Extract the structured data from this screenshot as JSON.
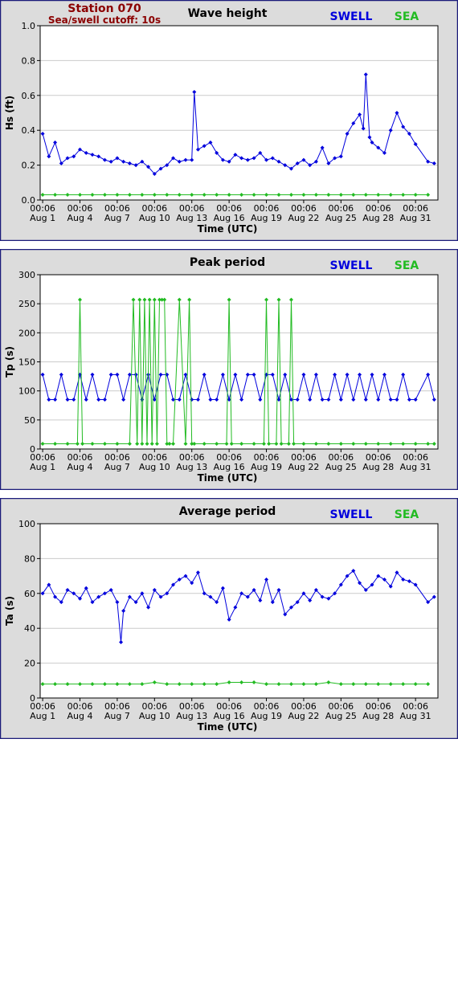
{
  "header": {
    "station": "Station 070",
    "cutoff": "Sea/swell cutoff: 10s"
  },
  "colors": {
    "swell": "#0000dd",
    "sea": "#22bb22",
    "frame": "#1a1a7a",
    "outer_bg": "#dcdcdc",
    "grid": "#cccccc"
  },
  "x_axis": {
    "label": "Time (UTC)",
    "days": 31,
    "ticks": [
      {
        "day": 1,
        "time": "00:06",
        "date": "Aug 1"
      },
      {
        "day": 4,
        "time": "00:06",
        "date": "Aug 4"
      },
      {
        "day": 7,
        "time": "00:06",
        "date": "Aug 7"
      },
      {
        "day": 10,
        "time": "00:06",
        "date": "Aug 10"
      },
      {
        "day": 13,
        "time": "00:06",
        "date": "Aug 13"
      },
      {
        "day": 16,
        "time": "00:06",
        "date": "Aug 16"
      },
      {
        "day": 19,
        "time": "00:06",
        "date": "Aug 19"
      },
      {
        "day": 22,
        "time": "00:06",
        "date": "Aug 22"
      },
      {
        "day": 25,
        "time": "00:06",
        "date": "Aug 25"
      },
      {
        "day": 28,
        "time": "00:06",
        "date": "Aug 28"
      },
      {
        "day": 31,
        "time": "00:06",
        "date": "Aug 31"
      }
    ]
  },
  "chart_data": [
    {
      "type": "line",
      "title": "Wave height",
      "ylabel": "Hs (ft)",
      "xlabel": "Time (UTC)",
      "ylim": [
        0,
        1.0
      ],
      "yticks": [
        "0.0",
        "0.2",
        "0.4",
        "0.6",
        "0.8",
        "1.0"
      ],
      "grid": true,
      "legend": "top-right",
      "series": [
        {
          "name": "SWELL",
          "color": "#0000dd",
          "x": [
            1.0,
            1.5,
            2.0,
            2.5,
            3.0,
            3.5,
            4.0,
            4.5,
            5.0,
            5.5,
            6.0,
            6.5,
            7.0,
            7.5,
            8.0,
            8.5,
            9.0,
            9.5,
            10.0,
            10.5,
            11.0,
            11.5,
            12.0,
            12.5,
            13.0,
            13.2,
            13.5,
            14.0,
            14.5,
            15.0,
            15.5,
            16.0,
            16.5,
            17.0,
            17.5,
            18.0,
            18.5,
            19.0,
            19.5,
            20.0,
            20.5,
            21.0,
            21.5,
            22.0,
            22.5,
            23.0,
            23.5,
            24.0,
            24.5,
            25.0,
            25.5,
            26.0,
            26.5,
            26.8,
            27.0,
            27.3,
            27.5,
            28.0,
            28.5,
            29.0,
            29.5,
            30.0,
            30.5,
            31.0,
            32.0,
            32.5
          ],
          "values": [
            0.38,
            0.25,
            0.33,
            0.21,
            0.24,
            0.25,
            0.29,
            0.27,
            0.26,
            0.25,
            0.23,
            0.22,
            0.24,
            0.22,
            0.21,
            0.2,
            0.22,
            0.19,
            0.15,
            0.18,
            0.2,
            0.24,
            0.22,
            0.23,
            0.23,
            0.62,
            0.29,
            0.31,
            0.33,
            0.27,
            0.23,
            0.22,
            0.26,
            0.24,
            0.23,
            0.24,
            0.27,
            0.23,
            0.24,
            0.22,
            0.2,
            0.18,
            0.21,
            0.23,
            0.2,
            0.22,
            0.3,
            0.21,
            0.24,
            0.25,
            0.38,
            0.44,
            0.49,
            0.41,
            0.72,
            0.36,
            0.33,
            0.3,
            0.27,
            0.4,
            0.5,
            0.42,
            0.38,
            0.32,
            0.22,
            0.21
          ]
        },
        {
          "name": "SEA",
          "color": "#22bb22",
          "x": [
            1.0,
            2.0,
            3.0,
            4.0,
            5.0,
            6.0,
            7.0,
            8.0,
            9.0,
            10.0,
            11.0,
            12.0,
            13.0,
            14.0,
            15.0,
            16.0,
            17.0,
            18.0,
            19.0,
            20.0,
            21.0,
            22.0,
            23.0,
            24.0,
            25.0,
            26.0,
            27.0,
            28.0,
            29.0,
            30.0,
            31.0,
            32.0
          ],
          "values": [
            0.03,
            0.03,
            0.03,
            0.03,
            0.03,
            0.03,
            0.03,
            0.03,
            0.03,
            0.03,
            0.03,
            0.03,
            0.03,
            0.03,
            0.03,
            0.03,
            0.03,
            0.03,
            0.03,
            0.03,
            0.03,
            0.03,
            0.03,
            0.03,
            0.03,
            0.03,
            0.03,
            0.03,
            0.03,
            0.03,
            0.03,
            0.03
          ]
        }
      ]
    },
    {
      "type": "line",
      "title": "Peak period",
      "ylabel": "Tp (s)",
      "xlabel": "Time (UTC)",
      "ylim": [
        0,
        300
      ],
      "yticks": [
        "0",
        "50",
        "100",
        "150",
        "200",
        "250",
        "300"
      ],
      "grid": true,
      "legend": "top-right",
      "series": [
        {
          "name": "SWELL",
          "color": "#0000dd",
          "x": [
            1.0,
            1.5,
            2.0,
            2.5,
            3.0,
            3.5,
            4.0,
            4.5,
            5.0,
            5.5,
            6.0,
            6.5,
            7.0,
            7.5,
            8.0,
            8.5,
            9.0,
            9.5,
            10.0,
            10.5,
            11.0,
            11.5,
            12.0,
            12.5,
            13.0,
            13.5,
            14.0,
            14.5,
            15.0,
            15.5,
            16.0,
            16.5,
            17.0,
            17.5,
            18.0,
            18.5,
            19.0,
            19.5,
            20.0,
            20.5,
            21.0,
            21.5,
            22.0,
            22.5,
            23.0,
            23.5,
            24.0,
            24.5,
            25.0,
            25.5,
            26.0,
            26.5,
            27.0,
            27.5,
            28.0,
            28.5,
            29.0,
            29.5,
            30.0,
            30.5,
            31.0,
            32.0,
            32.5
          ],
          "values": [
            128,
            85,
            85,
            128,
            85,
            85,
            128,
            85,
            128,
            85,
            85,
            128,
            128,
            85,
            128,
            128,
            85,
            128,
            85,
            128,
            128,
            85,
            85,
            128,
            85,
            85,
            128,
            85,
            85,
            128,
            85,
            128,
            85,
            128,
            128,
            85,
            128,
            128,
            85,
            128,
            85,
            85,
            128,
            85,
            128,
            85,
            85,
            128,
            85,
            128,
            85,
            128,
            85,
            128,
            85,
            128,
            85,
            85,
            128,
            85,
            85,
            128,
            85
          ]
        },
        {
          "name": "SEA",
          "color": "#22bb22",
          "x": [
            1.0,
            2.0,
            3.0,
            3.8,
            4.0,
            4.2,
            5.0,
            6.0,
            7.0,
            8.0,
            8.3,
            8.6,
            8.8,
            9.0,
            9.2,
            9.4,
            9.6,
            9.8,
            10.0,
            10.2,
            10.4,
            10.6,
            10.8,
            11.0,
            11.2,
            11.5,
            12.0,
            12.5,
            12.8,
            13.0,
            13.2,
            14.0,
            15.0,
            15.8,
            16.0,
            16.2,
            17.0,
            18.0,
            18.8,
            19.0,
            19.2,
            19.8,
            20.0,
            20.2,
            20.8,
            21.0,
            21.2,
            22.0,
            23.0,
            24.0,
            25.0,
            26.0,
            27.0,
            28.0,
            29.0,
            30.0,
            31.0,
            32.0,
            32.5
          ],
          "values": [
            9,
            9,
            9,
            9,
            257,
            9,
            9,
            9,
            9,
            9,
            257,
            9,
            257,
            9,
            257,
            9,
            257,
            9,
            257,
            9,
            257,
            257,
            257,
            9,
            9,
            9,
            257,
            9,
            257,
            9,
            9,
            9,
            9,
            9,
            257,
            9,
            9,
            9,
            9,
            257,
            9,
            9,
            257,
            9,
            9,
            257,
            9,
            9,
            9,
            9,
            9,
            9,
            9,
            9,
            9,
            9,
            9,
            9,
            9
          ]
        }
      ]
    },
    {
      "type": "line",
      "title": "Average period",
      "ylabel": "Ta (s)",
      "xlabel": "Time (UTC)",
      "ylim": [
        0,
        100
      ],
      "yticks": [
        "0",
        "20",
        "40",
        "60",
        "80",
        "100"
      ],
      "grid": true,
      "legend": "top-right",
      "series": [
        {
          "name": "SWELL",
          "color": "#0000dd",
          "x": [
            1.0,
            1.5,
            2.0,
            2.5,
            3.0,
            3.5,
            4.0,
            4.5,
            5.0,
            5.5,
            6.0,
            6.5,
            7.0,
            7.3,
            7.5,
            8.0,
            8.5,
            9.0,
            9.5,
            10.0,
            10.5,
            11.0,
            11.5,
            12.0,
            12.5,
            13.0,
            13.5,
            14.0,
            14.5,
            15.0,
            15.5,
            16.0,
            16.5,
            17.0,
            17.5,
            18.0,
            18.5,
            19.0,
            19.5,
            20.0,
            20.5,
            21.0,
            21.5,
            22.0,
            22.5,
            23.0,
            23.5,
            24.0,
            24.5,
            25.0,
            25.5,
            26.0,
            26.5,
            27.0,
            27.5,
            28.0,
            28.5,
            29.0,
            29.5,
            30.0,
            30.5,
            31.0,
            32.0,
            32.5
          ],
          "values": [
            60,
            65,
            58,
            55,
            62,
            60,
            57,
            63,
            55,
            58,
            60,
            62,
            55,
            32,
            50,
            58,
            55,
            60,
            52,
            62,
            58,
            60,
            65,
            68,
            70,
            66,
            72,
            60,
            58,
            55,
            63,
            45,
            52,
            60,
            58,
            62,
            56,
            68,
            55,
            62,
            48,
            52,
            55,
            60,
            56,
            62,
            58,
            57,
            60,
            65,
            70,
            73,
            66,
            62,
            65,
            70,
            68,
            64,
            72,
            68,
            67,
            65,
            55,
            58
          ]
        },
        {
          "name": "SEA",
          "color": "#22bb22",
          "x": [
            1.0,
            2.0,
            3.0,
            4.0,
            5.0,
            6.0,
            7.0,
            8.0,
            9.0,
            10.0,
            11.0,
            12.0,
            13.0,
            14.0,
            15.0,
            16.0,
            17.0,
            18.0,
            19.0,
            20.0,
            21.0,
            22.0,
            23.0,
            24.0,
            25.0,
            26.0,
            27.0,
            28.0,
            29.0,
            30.0,
            31.0,
            32.0
          ],
          "values": [
            8,
            8,
            8,
            8,
            8,
            8,
            8,
            8,
            8,
            9,
            8,
            8,
            8,
            8,
            8,
            9,
            9,
            9,
            8,
            8,
            8,
            8,
            8,
            9,
            8,
            8,
            8,
            8,
            8,
            8,
            8,
            8
          ]
        }
      ]
    }
  ]
}
